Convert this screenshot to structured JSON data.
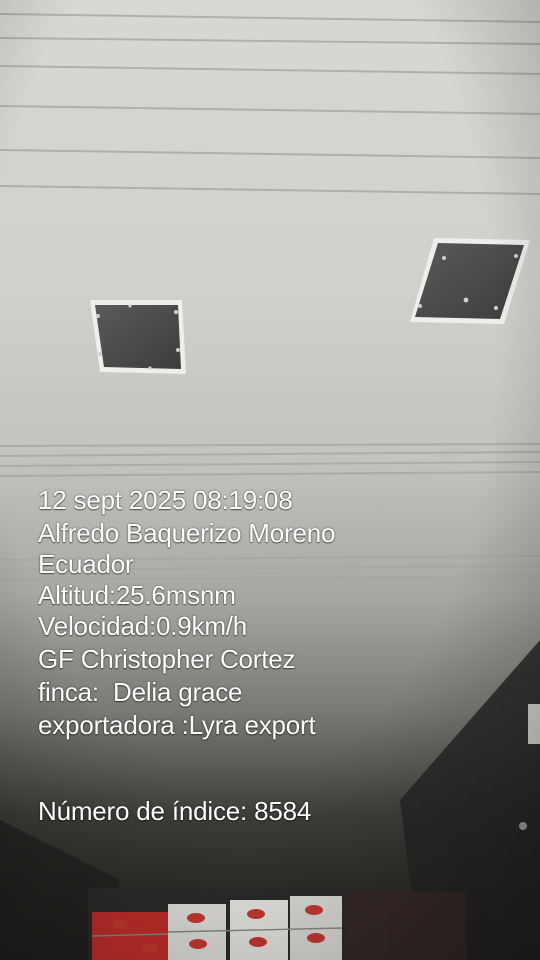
{
  "photo": {
    "subject": "",
    "colors": {
      "ceiling_light": "#d8d6d2",
      "ceiling_mid": "#bdbbb6",
      "ceiling_dark": "#3a3936",
      "vent_panel": "#4d4e4c",
      "overlay_text": "#ffffff"
    }
  },
  "stamp": {
    "datetime": "12 sept 2025 08:19:08",
    "location_line1": "Alfredo Baquerizo Moreno",
    "location_line2": "Ecuador",
    "altitude": "Altitud:25.6msnm",
    "speed": "Velocidad:0.9km/h",
    "gf": "GF Christopher Cortez",
    "farm": "finca:  Delia grace",
    "exporter": "exportadora :Lyra export",
    "index": "Número de índice: 8584"
  }
}
